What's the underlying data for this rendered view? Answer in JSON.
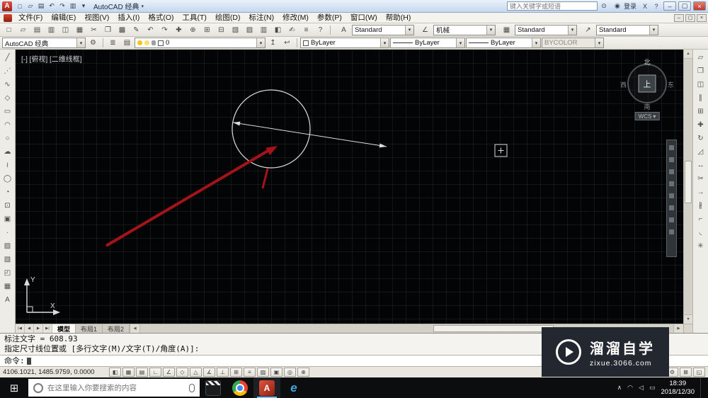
{
  "window": {
    "workspace": "AutoCAD 经典"
  },
  "colors": {
    "red_annotation": "#a3131a",
    "autocad_orange": "#d6452e",
    "taskbar_bg": "#0c0d0f",
    "drawing_bg": "#030405",
    "edge_blue": "#3fa9e0"
  },
  "ui": {
    "dropdown_arrow": "▾",
    "minimize": "–",
    "maximize": "▢",
    "close": "×",
    "help": "?",
    "search_glyph": "⊙",
    "user_glyph": "◉",
    "scroll_left": "◀",
    "scroll_right": "▶",
    "scroll_up": "▲",
    "scroll_down": "▼",
    "start_glyph": "⊞"
  },
  "titlebar": {
    "app_letter": "A",
    "workspace_label": "AutoCAD 经典",
    "search_placeholder": "键入关键字或短语",
    "signin_label": "登录",
    "exchange_label": "X",
    "quick_access": [
      {
        "n": "qnew-icon",
        "g": "□"
      },
      {
        "n": "open-icon",
        "g": "▱"
      },
      {
        "n": "save-icon",
        "g": "▤"
      },
      {
        "n": "undo-icon",
        "g": "↶"
      },
      {
        "n": "redo-icon",
        "g": "↷"
      },
      {
        "n": "plot-icon",
        "g": "▥"
      },
      {
        "n": "more-commands-icon",
        "g": "▾"
      }
    ]
  },
  "menubar": {
    "items": [
      {
        "label": "文件(F)",
        "n": "menu-file"
      },
      {
        "label": "编辑(E)",
        "n": "menu-edit"
      },
      {
        "label": "视图(V)",
        "n": "menu-view"
      },
      {
        "label": "插入(I)",
        "n": "menu-insert"
      },
      {
        "label": "格式(O)",
        "n": "menu-format"
      },
      {
        "label": "工具(T)",
        "n": "menu-tools"
      },
      {
        "label": "绘图(D)",
        "n": "menu-draw"
      },
      {
        "label": "标注(N)",
        "n": "menu-dimension"
      },
      {
        "label": "修改(M)",
        "n": "menu-modify"
      },
      {
        "label": "参数(P)",
        "n": "menu-parametric"
      },
      {
        "label": "窗口(W)",
        "n": "menu-window"
      },
      {
        "label": "帮助(H)",
        "n": "menu-help"
      }
    ]
  },
  "toolbar_standard": {
    "icons": [
      {
        "n": "qnew-icon",
        "g": "□"
      },
      {
        "n": "open-icon",
        "g": "▱"
      },
      {
        "n": "save-icon",
        "g": "▤"
      },
      {
        "n": "plot-icon",
        "g": "▥"
      },
      {
        "n": "plot-preview-icon",
        "g": "◫"
      },
      {
        "n": "publish-icon",
        "g": "▦"
      },
      {
        "n": "cut-icon",
        "g": "✂"
      },
      {
        "n": "copy-icon",
        "g": "❐"
      },
      {
        "n": "paste-icon",
        "g": "▩"
      },
      {
        "n": "match-properties-icon",
        "g": "✎"
      },
      {
        "n": "undo-icon",
        "g": "↶"
      },
      {
        "n": "redo-icon",
        "g": "↷"
      },
      {
        "n": "pan-icon",
        "g": "✚"
      },
      {
        "n": "zoom-realtime-icon",
        "g": "⊕"
      },
      {
        "n": "zoom-window-icon",
        "g": "⊞"
      },
      {
        "n": "zoom-previous-icon",
        "g": "⊟"
      },
      {
        "n": "properties-icon",
        "g": "▧"
      },
      {
        "n": "designcenter-icon",
        "g": "▨"
      },
      {
        "n": "tool-palettes-icon",
        "g": "▥"
      },
      {
        "n": "sheet-set-manager-icon",
        "g": "◧"
      },
      {
        "n": "markup-set-manager-icon",
        "g": "✍"
      },
      {
        "n": "quickcalc-icon",
        "g": "≡"
      },
      {
        "n": "help-icon",
        "g": "?"
      }
    ]
  },
  "toolbar_styles": {
    "groups": [
      {
        "icon_n": "text-style-icon",
        "icon_g": "A",
        "value": "Standard",
        "n": "text-style-select"
      },
      {
        "icon_n": "dim-style-icon",
        "icon_g": "∠",
        "value": "机械",
        "n": "dim-style-select"
      },
      {
        "icon_n": "table-style-icon",
        "icon_g": "▦",
        "value": "Standard",
        "n": "table-style-select"
      },
      {
        "icon_n": "mleader-style-icon",
        "icon_g": "↗",
        "value": "Standard",
        "n": "mleader-style-select"
      }
    ]
  },
  "toolbar_layers": {
    "workspace_value": "AutoCAD 经典",
    "gear": {
      "n": "workspace-settings-icon",
      "g": "⚙"
    },
    "icons_left": [
      {
        "n": "layer-properties-icon",
        "g": "≣"
      },
      {
        "n": "layer-states-icon",
        "g": "▤"
      }
    ],
    "layer_name": "0",
    "icons_right": [
      {
        "n": "make-object-layer-current-icon",
        "g": "↥"
      },
      {
        "n": "layer-previous-icon",
        "g": "↩"
      }
    ],
    "color_value": "ByLayer",
    "linetype_value": "ByLayer",
    "lineweight_value": "ByLayer",
    "plotstyle_value": "BYCOLOR"
  },
  "draw_toolbar": {
    "icons": [
      {
        "n": "line-icon",
        "g": "╱"
      },
      {
        "n": "construction-line-icon",
        "g": "⋰"
      },
      {
        "n": "polyline-icon",
        "g": "∿"
      },
      {
        "n": "polygon-icon",
        "g": "◇"
      },
      {
        "n": "rectangle-icon",
        "g": "▭"
      },
      {
        "n": "arc-icon",
        "g": "◠"
      },
      {
        "n": "circle-icon",
        "g": "○"
      },
      {
        "n": "revision-cloud-icon",
        "g": "☁"
      },
      {
        "n": "spline-icon",
        "g": "≀"
      },
      {
        "n": "ellipse-icon",
        "g": "◯"
      },
      {
        "n": "ellipse-arc-icon",
        "g": "◔"
      },
      {
        "n": "insert-block-icon",
        "g": "⊡"
      },
      {
        "n": "create-block-icon",
        "g": "▣"
      },
      {
        "n": "point-icon",
        "g": "∙"
      },
      {
        "n": "hatch-icon",
        "g": "▨"
      },
      {
        "n": "gradient-icon",
        "g": "▧"
      },
      {
        "n": "region-icon",
        "g": "◰"
      },
      {
        "n": "table-icon",
        "g": "▦"
      },
      {
        "n": "multiline-text-icon",
        "g": "A"
      }
    ]
  },
  "modify_toolbar": {
    "icons": [
      {
        "n": "erase-icon",
        "g": "▱"
      },
      {
        "n": "copy-icon",
        "g": "❐"
      },
      {
        "n": "mirror-icon",
        "g": "◫"
      },
      {
        "n": "offset-icon",
        "g": "∥"
      },
      {
        "n": "array-icon",
        "g": "⊞"
      },
      {
        "n": "move-icon",
        "g": "✚"
      },
      {
        "n": "rotate-icon",
        "g": "↻"
      },
      {
        "n": "scale-icon",
        "g": "◿"
      },
      {
        "n": "stretch-icon",
        "g": "↔"
      },
      {
        "n": "trim-icon",
        "g": "✂"
      },
      {
        "n": "extend-icon",
        "g": "→"
      },
      {
        "n": "break-icon",
        "g": "∦"
      },
      {
        "n": "chamfer-icon",
        "g": "⌐"
      },
      {
        "n": "fillet-icon",
        "g": "◟"
      },
      {
        "n": "explode-icon",
        "g": "✳"
      }
    ]
  },
  "drawing": {
    "viewport_label": "[-] [俯视] [二维线框]",
    "viewcube": {
      "north": "北",
      "south": "南",
      "west": "西",
      "east": "东",
      "top": "上",
      "wcs_label": "WCS"
    },
    "ucs": {
      "x_label": "X",
      "y_label": "Y"
    }
  },
  "tabs": {
    "nav": [
      {
        "n": "tab-first-button",
        "g": "|◀"
      },
      {
        "n": "tab-prev-button",
        "g": "◀"
      },
      {
        "n": "tab-next-button",
        "g": "▶"
      },
      {
        "n": "tab-last-button",
        "g": "▶|"
      }
    ],
    "items": [
      {
        "label": "模型",
        "n": "tab-model",
        "cls": "tab active"
      },
      {
        "label": "布局1",
        "n": "tab-layout1",
        "cls": "tab"
      },
      {
        "label": "布局2",
        "n": "tab-layout2",
        "cls": "tab"
      }
    ]
  },
  "command": {
    "lines": [
      "标注文字 = 608.93",
      "指定尺寸线位置或 [多行文字(M)/文字(T)/角度(A)]:"
    ],
    "prompt": "命令:"
  },
  "statusbar": {
    "coordinates": "4106.1021, 1485.9759, 0.0000",
    "toggles": [
      {
        "n": "infer-constraints-toggle",
        "g": "◧"
      },
      {
        "n": "snap-toggle",
        "g": "▦"
      },
      {
        "n": "grid-toggle",
        "g": "▤"
      },
      {
        "n": "ortho-toggle",
        "g": "∟"
      },
      {
        "n": "polar-tracking-toggle",
        "g": "∠"
      },
      {
        "n": "osnap-toggle",
        "g": "◇"
      },
      {
        "n": "osnap-3d-toggle",
        "g": "△"
      },
      {
        "n": "otrack-toggle",
        "g": "∡"
      },
      {
        "n": "ducs-toggle",
        "g": "⊥"
      },
      {
        "n": "dynamic-input-toggle",
        "g": "⊞"
      },
      {
        "n": "lineweight-toggle",
        "g": "≡"
      },
      {
        "n": "transparency-toggle",
        "g": "▨"
      },
      {
        "n": "quick-properties-toggle",
        "g": "▣"
      },
      {
        "n": "selection-cycling-toggle",
        "g": "◎"
      },
      {
        "n": "annotation-monitor-toggle",
        "g": "⊕"
      }
    ],
    "right_icons": [
      {
        "n": "model-space-button",
        "g": "▣"
      },
      {
        "n": "quick-view-layouts-button",
        "g": "▦"
      },
      {
        "n": "quick-view-drawings-button",
        "g": "◫"
      },
      {
        "n": "annotation-scale-button",
        "g": "△"
      },
      {
        "n": "annotation-visibility-button",
        "g": "◎"
      },
      {
        "n": "autoscale-button",
        "g": "⊕"
      },
      {
        "n": "workspace-switch-button",
        "g": "⚙"
      },
      {
        "n": "toolbar-lock-button",
        "g": "⊠"
      },
      {
        "n": "clean-screen-button",
        "g": "◱"
      }
    ]
  },
  "taskbar": {
    "search_placeholder": "在这里输入你要搜索的内容",
    "autocad_letter": "A",
    "edge_letter": "e",
    "tray": [
      {
        "n": "tray-expand-icon",
        "g": "∧"
      },
      {
        "n": "network-icon",
        "g": "◠"
      },
      {
        "n": "volume-icon",
        "g": "◁"
      },
      {
        "n": "battery-icon",
        "g": "▭"
      }
    ],
    "time": "18:39",
    "date": "2018/12/30"
  },
  "watermark": {
    "title": "溜溜自学",
    "url": "zixue.3066.com"
  }
}
